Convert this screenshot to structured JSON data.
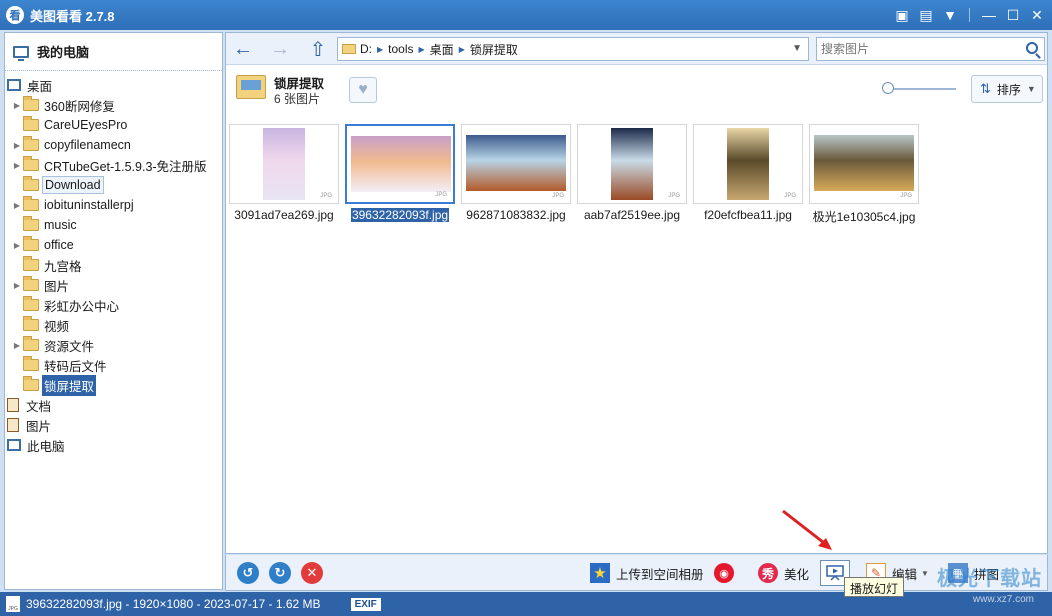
{
  "window": {
    "app_icon": "看",
    "title": "美图看看 2.7.8",
    "buttons": [
      "chat-icon",
      "menu-icon",
      "skin-icon",
      "minimize-icon",
      "maximize-icon",
      "close-icon"
    ]
  },
  "sidebar": {
    "header": "我的电脑",
    "root": "桌面",
    "items": [
      {
        "label": "360断网修复",
        "expandable": true
      },
      {
        "label": "CareUEyesPro",
        "expandable": false
      },
      {
        "label": "copyfilenamecn",
        "expandable": true
      },
      {
        "label": "CRTubeGet-1.5.9.3-免注册版",
        "expandable": true
      },
      {
        "label": "Download",
        "expandable": false,
        "state": "hover"
      },
      {
        "label": "iobituninstallerpj",
        "expandable": true
      },
      {
        "label": "music",
        "expandable": false
      },
      {
        "label": "office",
        "expandable": true
      },
      {
        "label": "九宫格",
        "expandable": false
      },
      {
        "label": "图片",
        "expandable": true
      },
      {
        "label": "彩虹办公中心",
        "expandable": false
      },
      {
        "label": "视频",
        "expandable": false
      },
      {
        "label": "资源文件",
        "expandable": true
      },
      {
        "label": "转码后文件",
        "expandable": false
      },
      {
        "label": "锁屏提取",
        "expandable": false,
        "state": "selected"
      }
    ],
    "other": [
      "文档",
      "图片",
      "此电脑"
    ]
  },
  "navbar": {
    "drive": "D:",
    "crumbs": [
      "tools",
      "桌面",
      "锁屏提取"
    ],
    "search_placeholder": "搜索图片"
  },
  "folder_info": {
    "name": "锁屏提取",
    "count": "6 张图片",
    "sort_label": "排序",
    "zoom_level": 0.05
  },
  "thumbnails": [
    {
      "name": "3091ad7ea269.jpg",
      "tag": "JPG",
      "orientation": "portrait",
      "selected": false
    },
    {
      "name": "39632282093f.jpg",
      "tag": "JPG",
      "orientation": "landscape",
      "selected": true
    },
    {
      "name": "962871083832.jpg",
      "tag": "JPG",
      "orientation": "landscape",
      "selected": false
    },
    {
      "name": "aab7af2519ee.jpg",
      "tag": "JPG",
      "orientation": "portrait",
      "selected": false
    },
    {
      "name": "f20efcfbea11.jpg",
      "tag": "JPG",
      "orientation": "portrait",
      "selected": false
    },
    {
      "name": "极光1e10305c4.jpg",
      "tag": "JPG",
      "orientation": "landscape",
      "selected": false
    }
  ],
  "toolbar": {
    "upload": "上传到空间相册",
    "beautify_icon": "秀",
    "beautify": "美化",
    "edit": "编辑",
    "puzzle": "拼图",
    "slideshow_tooltip": "播放幻灯"
  },
  "status": {
    "file_tag": "JPG",
    "text": "39632282093f.jpg - 1920×1080 - 2023-07-17 - 1.62 MB",
    "exif": "EXIF"
  },
  "watermark": {
    "text": "极光下载站",
    "sub": "www.xz7.com"
  }
}
